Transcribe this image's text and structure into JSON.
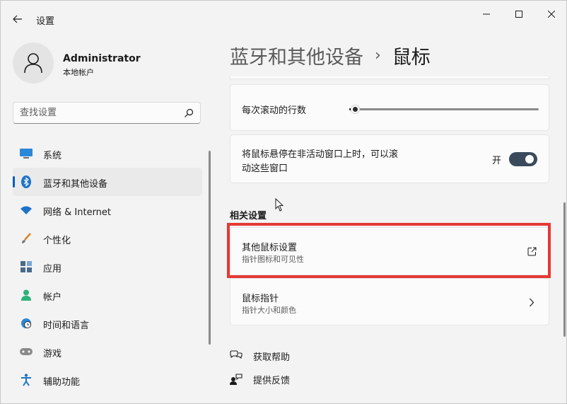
{
  "app": {
    "title": "设置"
  },
  "user": {
    "name": "Administrator",
    "account_type": "本地帐户"
  },
  "search": {
    "placeholder": "查找设置"
  },
  "nav": {
    "items": [
      {
        "label": "系统",
        "icon": "system-icon",
        "active": false
      },
      {
        "label": "蓝牙和其他设备",
        "icon": "bluetooth-icon",
        "active": true
      },
      {
        "label": "网络 & Internet",
        "icon": "wifi-icon",
        "active": false
      },
      {
        "label": "个性化",
        "icon": "brush-icon",
        "active": false
      },
      {
        "label": "应用",
        "icon": "apps-icon",
        "active": false
      },
      {
        "label": "帐户",
        "icon": "account-icon",
        "active": false
      },
      {
        "label": "时间和语言",
        "icon": "clock-globe-icon",
        "active": false
      },
      {
        "label": "游戏",
        "icon": "gamepad-icon",
        "active": false
      },
      {
        "label": "辅助功能",
        "icon": "accessibility-icon",
        "active": false
      }
    ]
  },
  "breadcrumb": {
    "parent": "蓝牙和其他设备",
    "separator": "›",
    "current": "鼠标"
  },
  "settings": {
    "scroll_lines": {
      "label": "每次滚动的行数",
      "value": 3,
      "max": 100
    },
    "inactive_scroll": {
      "label_line1": "将鼠标悬停在非活动窗口上时，可以滚",
      "label_line2": "动这些窗口",
      "state_label": "开",
      "on": true
    }
  },
  "related": {
    "title": "相关设置",
    "items": [
      {
        "label": "其他鼠标设置",
        "sub": "指针图标和可见性",
        "icon": "open-external-icon"
      },
      {
        "label": "鼠标指针",
        "sub": "指针大小和颜色",
        "icon": "chevron-right-icon"
      }
    ]
  },
  "footer_links": [
    {
      "label": "获取帮助",
      "icon": "help-icon"
    },
    {
      "label": "提供反馈",
      "icon": "feedback-icon"
    }
  ],
  "colors": {
    "accent": "#005fb8",
    "highlight": "#e53935",
    "toggle_on": "#3a4a5c"
  }
}
